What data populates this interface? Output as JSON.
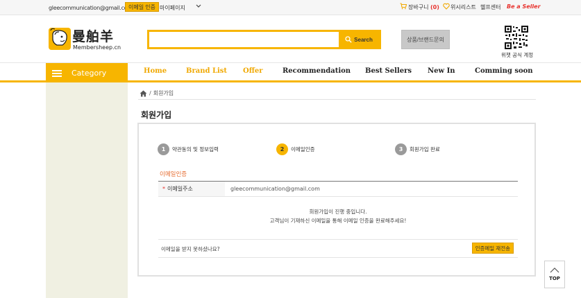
{
  "topbar": {
    "email": "gleecommunication@gmail.com 님",
    "verify_button": "이메일 인증",
    "mypage": "마이페이지",
    "cart_label": "장바구니",
    "cart_count": "(0)",
    "wishlist": "위시리스트",
    "help_center": "헬프센터",
    "seller": "Be a Seller"
  },
  "header": {
    "logo_cn": "曼舶羊",
    "logo_en": "Membersheep.cn",
    "search_placeholder": "",
    "search_button": "Search",
    "inquiry_button": "상품/브랜드문의",
    "qr_label": "위챗 공식 계정"
  },
  "nav": {
    "category": "Category",
    "items": [
      "Home",
      "Brand List",
      "Offer",
      "Recommendation",
      "Best Sellers",
      "New In",
      "Comming soon"
    ]
  },
  "breadcrumb": {
    "current": "회원가입"
  },
  "page": {
    "title": "회원가입"
  },
  "steps": [
    {
      "num": "1",
      "label": "약관동의 및 정보입력"
    },
    {
      "num": "2",
      "label": "이메일인증"
    },
    {
      "num": "3",
      "label": "회원가입 완료"
    }
  ],
  "form": {
    "section_title": "이메일인증",
    "email_label": "이메일주소",
    "required_mark": "*",
    "email_value": "gleecommunication@gmail.com",
    "notice_line1": "회원가입이 진행 중입니다.",
    "notice_line2": "고객님이 기재하신 이메일을 통해 이메일 인증을 완료해주세요!",
    "resend_question": "이메일을 받지 못하셨나요?",
    "resend_button": "인증메일 재전송"
  },
  "top_button": "TOP",
  "colors": {
    "accent": "#f7b500",
    "seller": "#e8322d",
    "section_title": "#e66a2c"
  }
}
